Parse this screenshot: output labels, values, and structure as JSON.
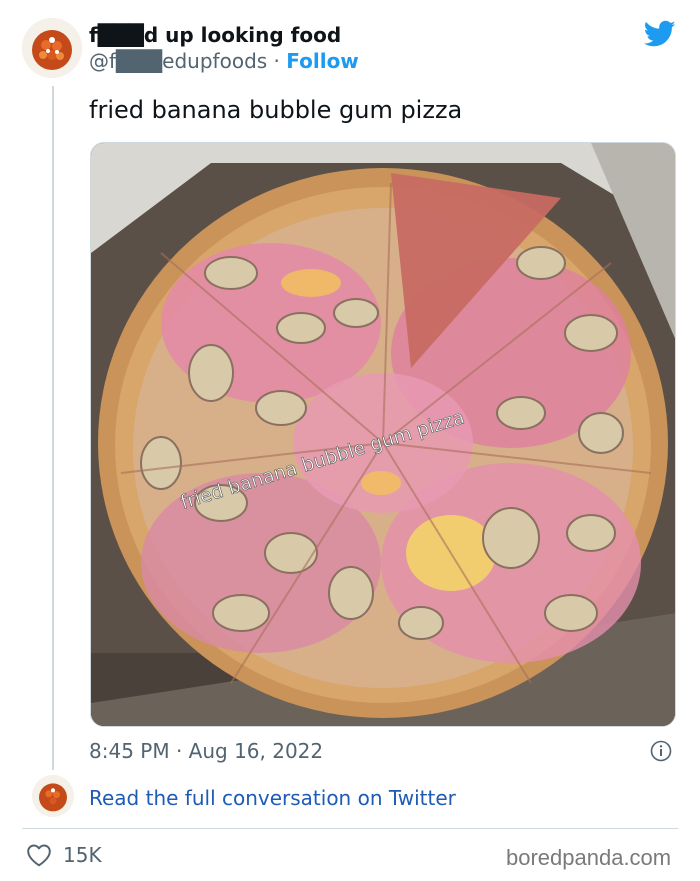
{
  "tweet": {
    "display_name": "f███d up looking food",
    "handle": "@f███edupfoods",
    "separator": " · ",
    "follow_label": "Follow",
    "text": "fried banana bubble gum pizza",
    "image_caption": "fried banana bubble gum pizza",
    "timestamp": "8:45 PM · Aug 16, 2022",
    "read_conversation_label": "Read the full conversation on Twitter",
    "likes": "15K",
    "icons": [
      "twitter-bird-icon",
      "info-icon",
      "heart-icon"
    ]
  },
  "colors": {
    "twitter_blue": "#1d9bf0",
    "link_blue": "#1d5bb5",
    "muted_text": "#536471",
    "pizza_pink": "#e58aa8"
  },
  "watermark": "boredpanda.com"
}
